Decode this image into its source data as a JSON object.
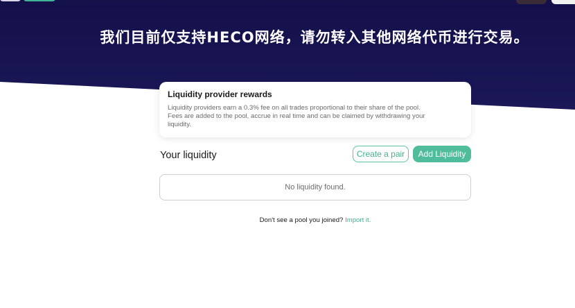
{
  "header": {
    "notice": "我们目前仅支持HECO网络，请勿转入其他网络代币进行交易。"
  },
  "rewards": {
    "title": "Liquidity provider rewards",
    "line1": "Liquidity providers earn a 0.3% fee on all trades proportional to their share of the pool.",
    "line2": "Fees are added to the pool, accrue in real time and can be claimed by withdrawing your",
    "line3": "liquidity."
  },
  "liquidity": {
    "heading": "Your liquidity",
    "create_pair_label": "Create a pair",
    "add_liquidity_label": "Add Liquidity",
    "empty_message": "No liquidity found.",
    "import_prompt": "Don't see a pool you joined?",
    "import_link": "Import it."
  },
  "colors": {
    "hero_bg": "#13104a",
    "accent": "#4fbd9b",
    "accent_text": "#3fb08e"
  }
}
